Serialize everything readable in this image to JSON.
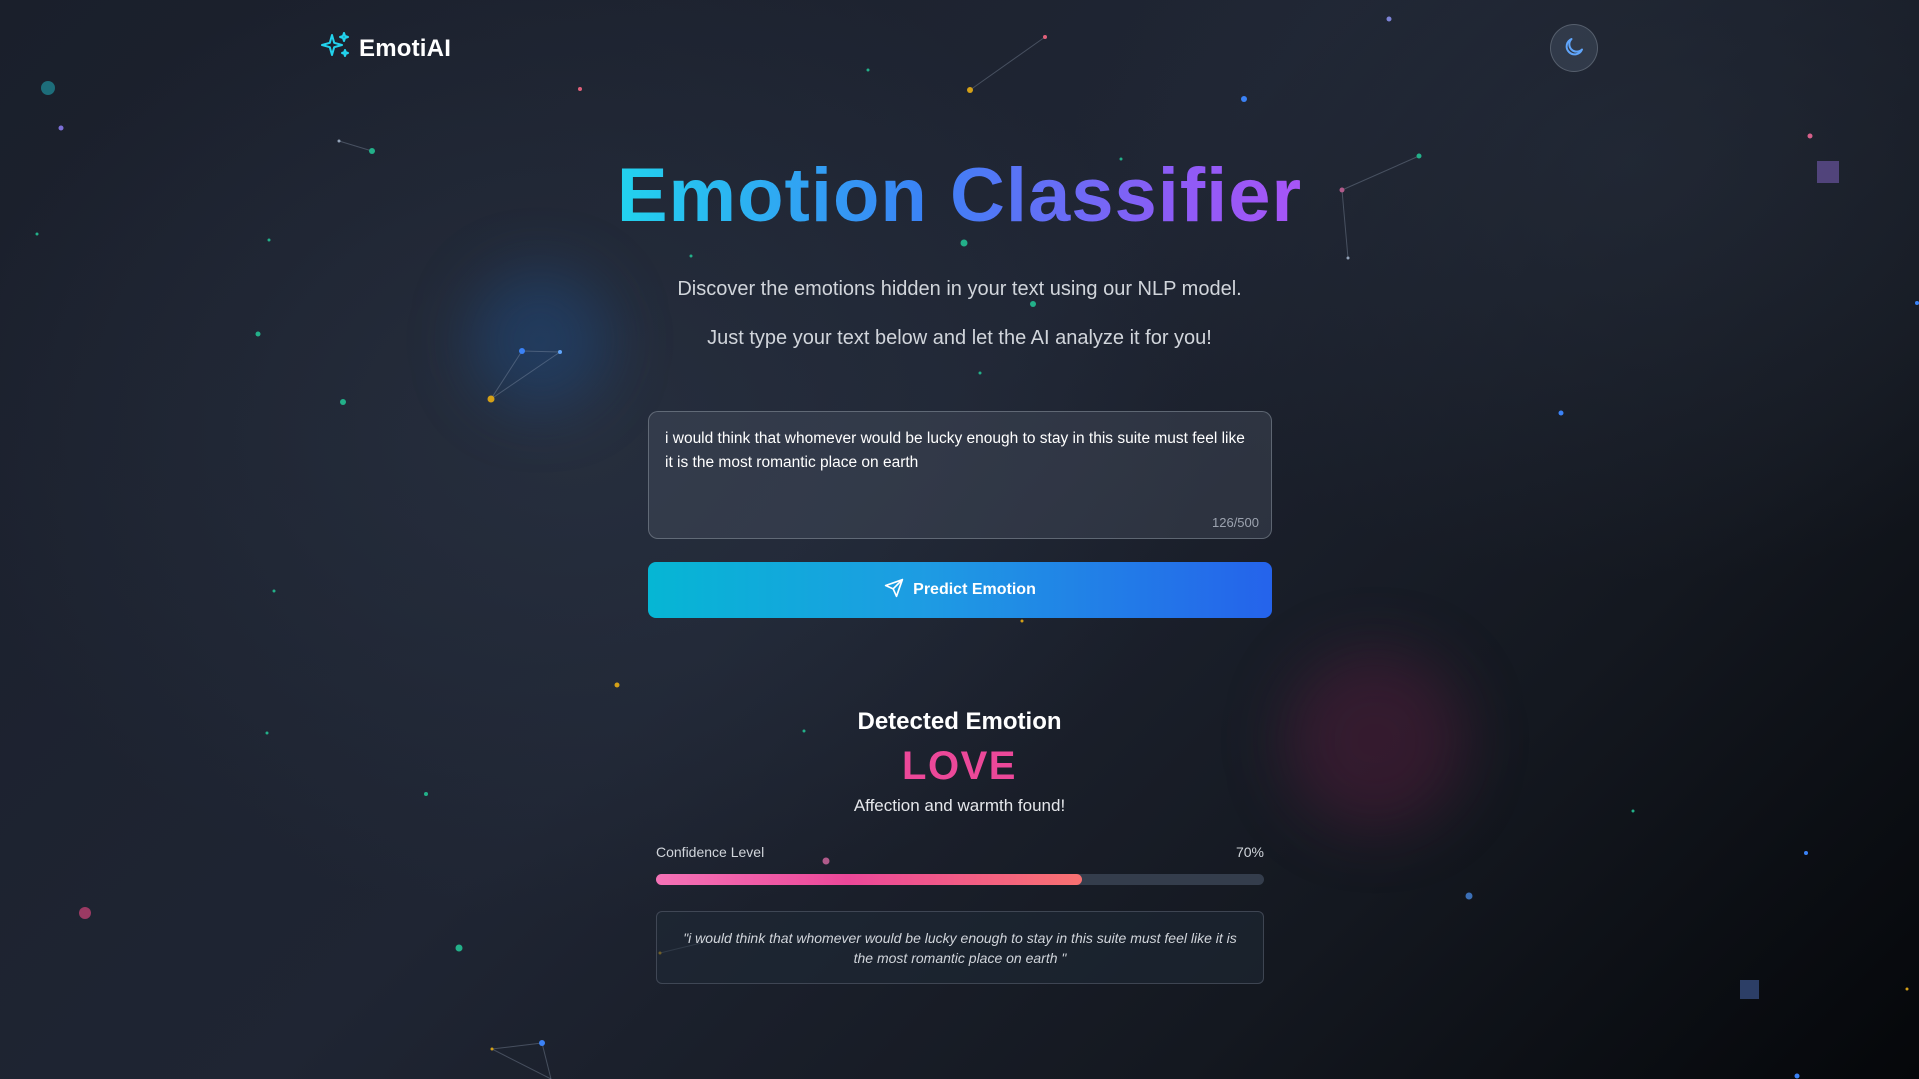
{
  "brand": {
    "name": "EmotiAI"
  },
  "hero": {
    "title": "Emotion Classifier",
    "subtitle_line1": "Discover the emotions hidden in your text using our NLP model.",
    "subtitle_line2": "Just type your text below and let the AI analyze it for you!"
  },
  "input": {
    "value": "i would think that whomever would be lucky enough to stay in this suite must feel like it is the most romantic place on earth",
    "char_count": "126/500"
  },
  "actions": {
    "predict_label": "Predict Emotion"
  },
  "result": {
    "heading": "Detected Emotion",
    "emotion": "LOVE",
    "description": "Affection and warmth found!",
    "confidence_label": "Confidence Level",
    "confidence_text": "70%",
    "confidence_fraction": 0.7,
    "quote": "\"i would think that whomever would be lucky enough to stay in this suite must feel like it is the most romantic place on earth \""
  },
  "icons": {
    "logo": "sparkles-icon",
    "theme_toggle": "moon-icon",
    "predict": "send-icon"
  },
  "colors": {
    "emotion": "#ec4899",
    "accent_start": "#06b6d4",
    "accent_end": "#2563eb"
  }
}
